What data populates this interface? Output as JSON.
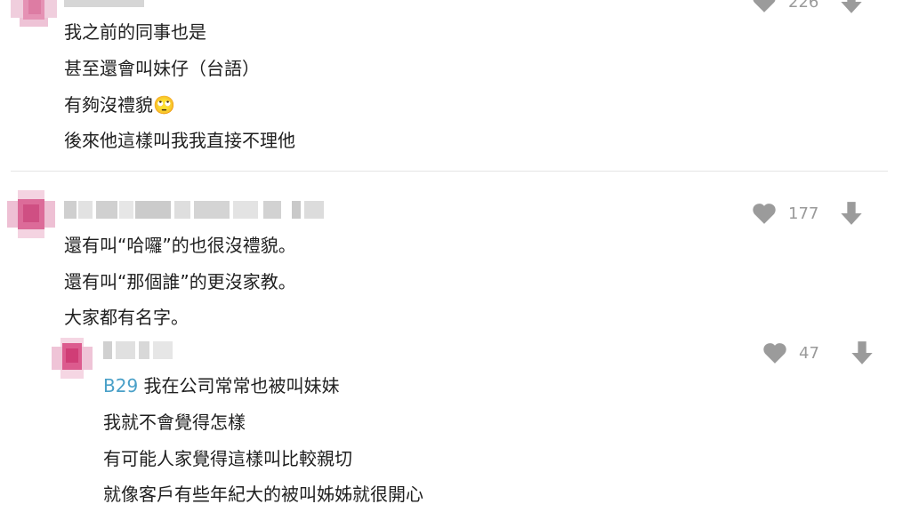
{
  "comments": [
    {
      "likes": "226",
      "lines": [
        "我之前的同事也是",
        "甚至還會叫妹仔（台語）",
        "有夠沒禮貌",
        "後來他這樣叫我我直接不理他"
      ],
      "emoji": "🙄"
    },
    {
      "likes": "177",
      "lines": [
        "還有叫“哈囉”的也很沒禮貌。",
        "還有叫“那個誰”的更沒家教。",
        "大家都有名字。"
      ]
    },
    {
      "likes": "47",
      "tag": "B29",
      "lines": [
        "我在公司常常也被叫妹妹",
        "我就不會覺得怎樣",
        "有可能人家覺得這樣叫比較親切",
        "就像客戶有些年紀大的被叫姊姊就很開心"
      ]
    }
  ],
  "icons": {
    "like": "heart-icon",
    "dislike": "down-arrow-icon"
  },
  "colors": {
    "tag": "#4aa0c8",
    "count": "#9a9a9a",
    "icon": "#9b9b9b",
    "avatar": "#d94f86"
  }
}
